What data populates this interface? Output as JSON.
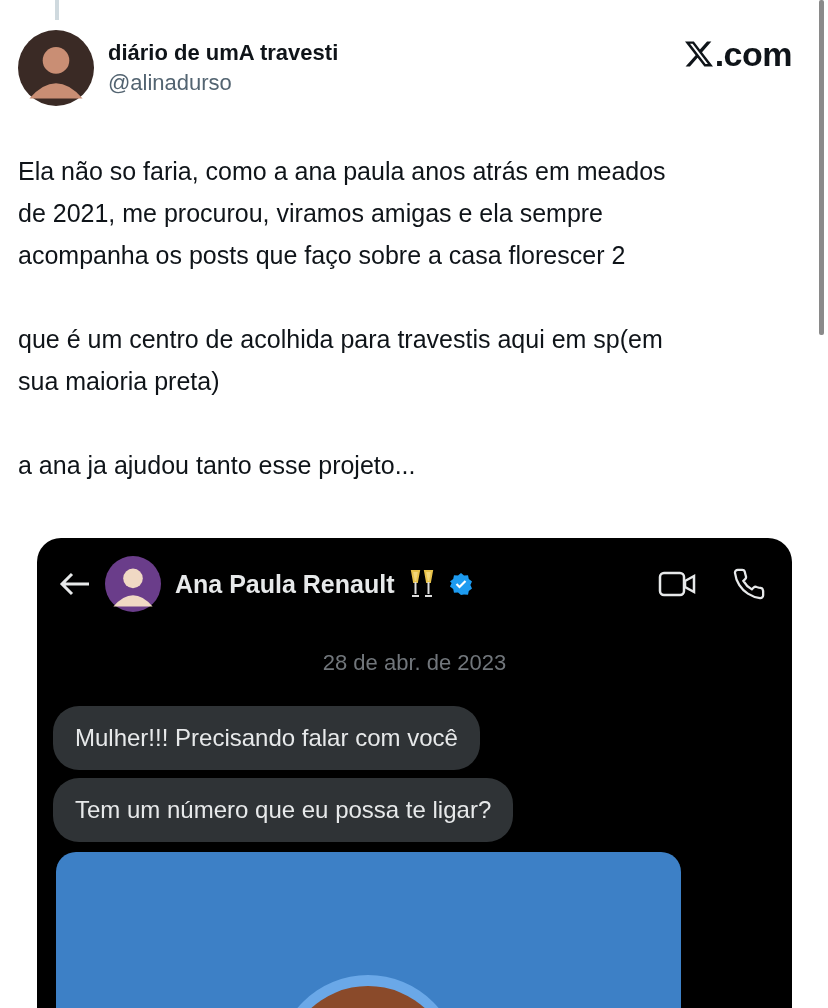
{
  "author": {
    "name": "diário de umA travesti",
    "handle": "@alinadurso"
  },
  "brand": {
    "suffix": ".com"
  },
  "paragraphs": [
    {
      "lines": [
        "Ela não so faria, como a ana paula anos atrás em meados",
        "de 2021, me procurou, viramos amigas e ela sempre",
        "acompanha os posts que faço sobre a casa florescer 2"
      ]
    },
    {
      "lines": [
        "que é um centro de acolhida para travestis aqui em sp(em",
        "sua maioria preta)"
      ]
    },
    {
      "lines": [
        "a ana ja ajudou tanto esse projeto..."
      ]
    }
  ],
  "dm": {
    "contact": {
      "name": "Ana Paula Renault",
      "verified": true
    },
    "date": "28 de abr. de 2023",
    "messages": [
      {
        "text": "Mulher!!! Precisando falar com você"
      },
      {
        "text": "Tem um número que eu possa te ligar?"
      }
    ]
  }
}
